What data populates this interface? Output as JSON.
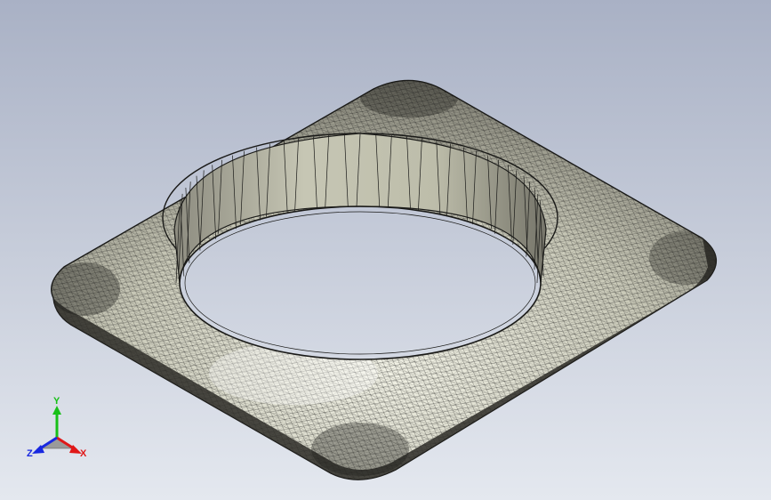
{
  "viewport": {
    "background_top": "#a9b1c5",
    "background_bottom": "#e4e8ef",
    "mesh_line_color": "#1a1a18",
    "part_face_color": "#d6d6c6",
    "part_shadow_color": "#6e6d63"
  },
  "triad": {
    "y_label": "Y",
    "x_label": "X",
    "z_label": "Z",
    "y_color": "#18c018",
    "x_color": "#e01818",
    "z_color": "#1828e0"
  }
}
